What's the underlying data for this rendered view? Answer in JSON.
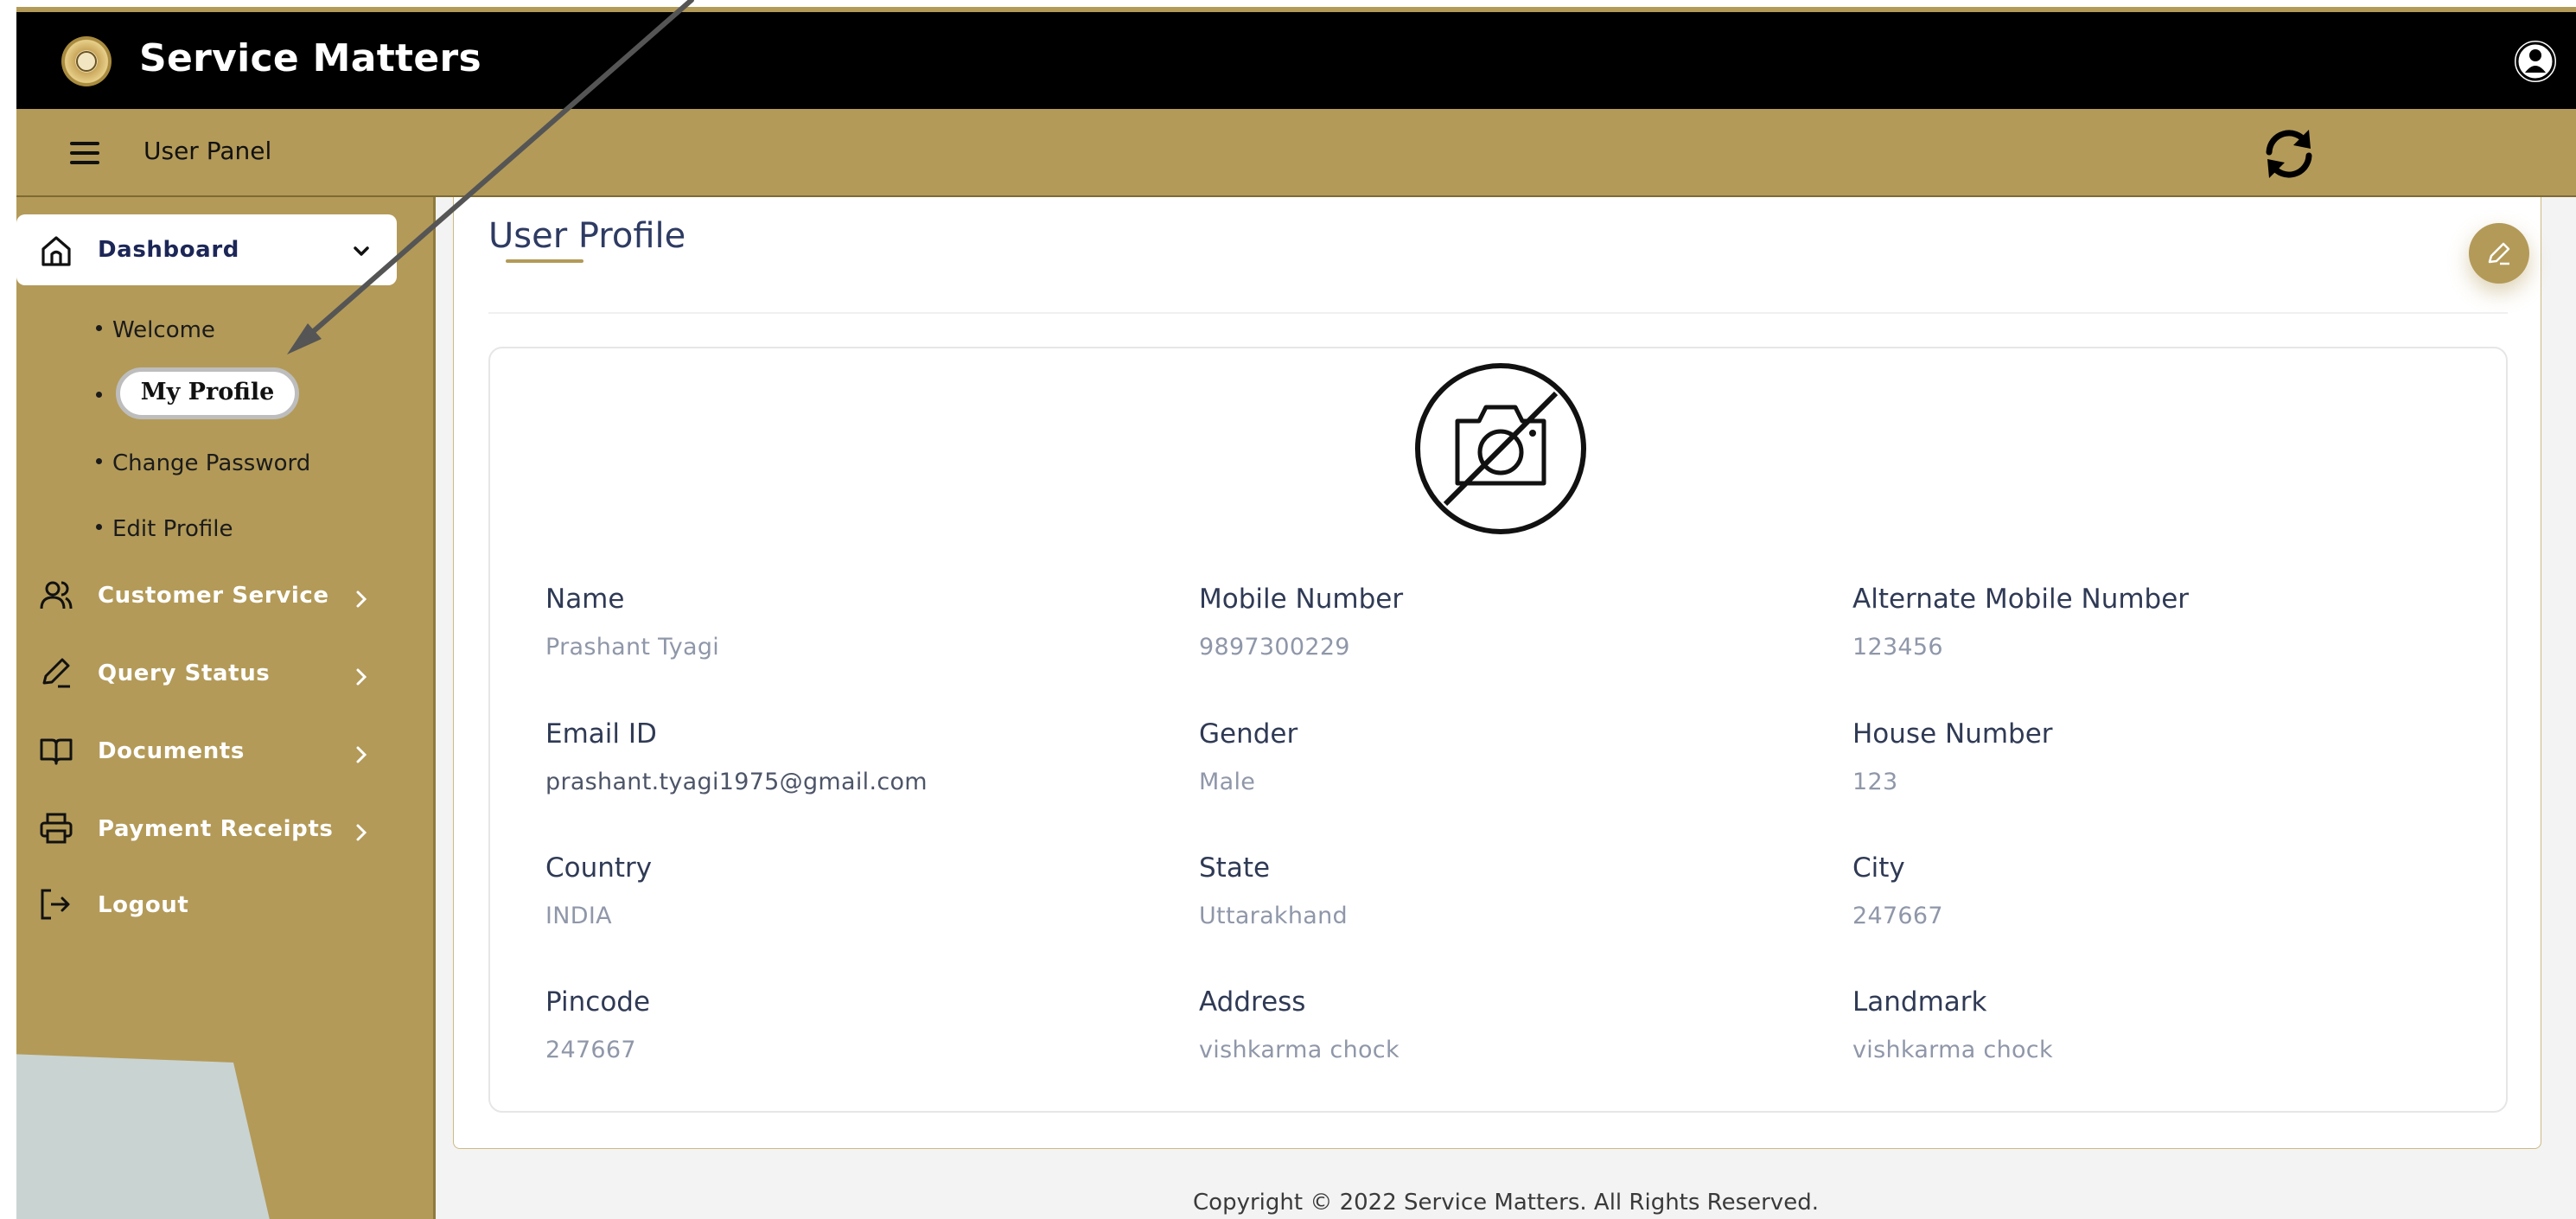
{
  "header": {
    "app_title": "Service Matters",
    "panel_label": "User Panel",
    "logo_icon": "emblem-logo",
    "user_icon": "user-circle-icon",
    "refresh_icon": "refresh-icon"
  },
  "colors": {
    "brand_gold": "#b39a58",
    "topbar": "#000000",
    "title_text": "#2e3b63"
  },
  "sidebar": {
    "dashboard": {
      "label": "Dashboard",
      "icon": "home-icon"
    },
    "submenu": [
      {
        "label": "Welcome"
      },
      {
        "label": "My Profile"
      },
      {
        "label": "Change Password"
      },
      {
        "label": "Edit Profile"
      }
    ],
    "items": [
      {
        "label": "Customer Service",
        "icon": "users-icon"
      },
      {
        "label": "Query Status",
        "icon": "pencil-icon"
      },
      {
        "label": "Documents",
        "icon": "book-icon"
      },
      {
        "label": "Payment Receipts",
        "icon": "printer-icon"
      },
      {
        "label": "Logout",
        "icon": "logout-icon"
      }
    ]
  },
  "profile": {
    "title": "User Profile",
    "avatar_icon": "no-photo-camera-icon",
    "edit_icon": "edit-pencil-icon",
    "fields": [
      {
        "label": "Name",
        "value": "Prashant Tyagi"
      },
      {
        "label": "Mobile Number",
        "value": "9897300229"
      },
      {
        "label": "Alternate Mobile Number",
        "value": "123456"
      },
      {
        "label": "Email ID",
        "value": "prashant.tyagi1975@gmail.com"
      },
      {
        "label": "Gender",
        "value": "Male"
      },
      {
        "label": "House Number",
        "value": "123"
      },
      {
        "label": "Country",
        "value": "INDIA"
      },
      {
        "label": "State",
        "value": "Uttarakhand"
      },
      {
        "label": "City",
        "value": "247667"
      },
      {
        "label": "Pincode",
        "value": "247667"
      },
      {
        "label": "Address",
        "value": "vishkarma chock"
      },
      {
        "label": "Landmark",
        "value": "vishkarma chock"
      }
    ]
  },
  "footer": {
    "copyright": "Copyright © 2022 Service Matters. All Rights Reserved."
  }
}
